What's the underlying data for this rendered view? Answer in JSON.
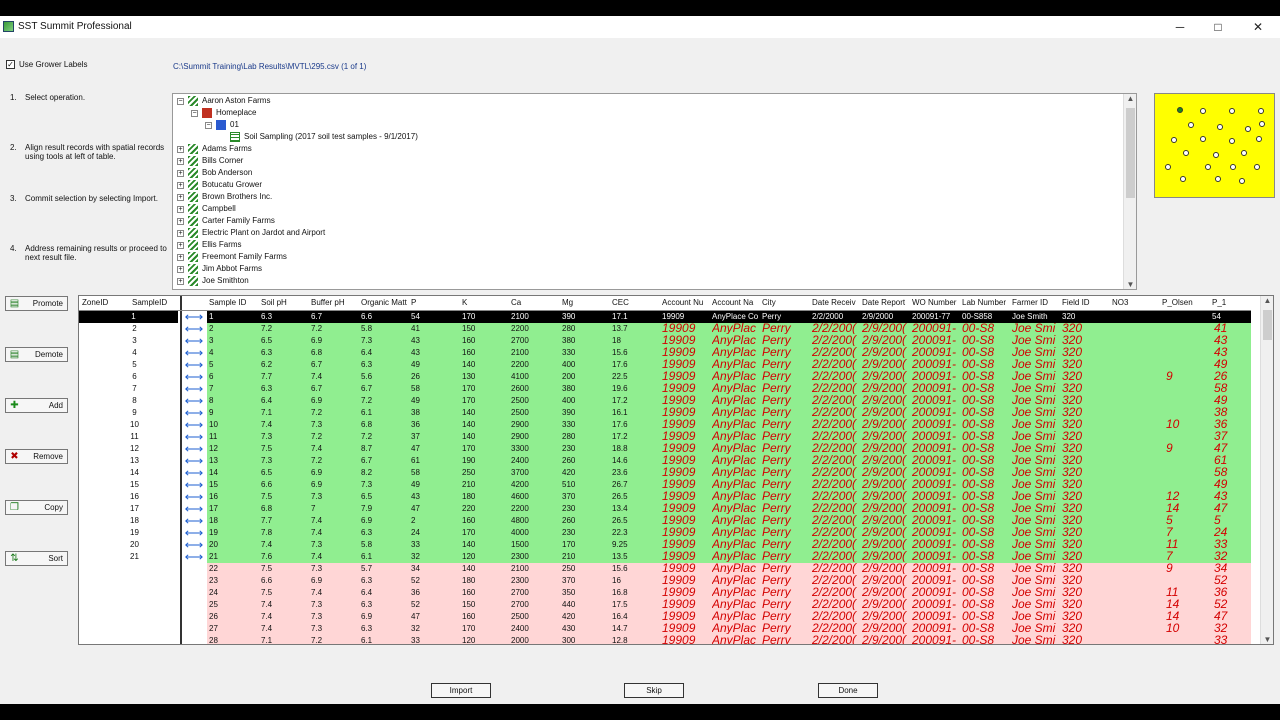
{
  "window": {
    "title": "SST Summit Professional",
    "minimize": "─",
    "maximize": "□",
    "close": "✕"
  },
  "options": {
    "use_grower_labels": "Use Grower Labels",
    "checked": "✓"
  },
  "file_path": "C:\\Summit Training\\Lab Results\\MVTL\\295.csv (1 of 1)",
  "steps": [
    {
      "num": "1.",
      "text": "Select operation."
    },
    {
      "num": "2.",
      "text": "Align result records with spatial records using tools at left of table."
    },
    {
      "num": "3.",
      "text": "Commit selection by selecting Import."
    },
    {
      "num": "4.",
      "text": "Address remaining results or proceed to next result file."
    }
  ],
  "tree": [
    {
      "exp": "−",
      "label": "Aaron Aston Farms",
      "level": 0,
      "icon": "farm-icon"
    },
    {
      "exp": "−",
      "label": "Homeplace",
      "level": 1,
      "icon": "barn-icon"
    },
    {
      "exp": "−",
      "label": "01",
      "level": 2,
      "icon": "field-icon"
    },
    {
      "exp": "",
      "label": "Soil Sampling (2017 soil test samples - 9/1/2017)",
      "level": 3,
      "icon": "sampling-icon"
    },
    {
      "exp": "+",
      "label": "Adams Farms",
      "level": 0,
      "icon": "farm-icon"
    },
    {
      "exp": "+",
      "label": "Bills Corner",
      "level": 0,
      "icon": "farm-icon"
    },
    {
      "exp": "+",
      "label": "Bob Anderson",
      "level": 0,
      "icon": "farm-icon"
    },
    {
      "exp": "+",
      "label": "Botucatu Grower",
      "level": 0,
      "icon": "farm-icon"
    },
    {
      "exp": "+",
      "label": "Brown Brothers Inc.",
      "level": 0,
      "icon": "farm-icon"
    },
    {
      "exp": "+",
      "label": "Campbell",
      "level": 0,
      "icon": "farm-icon"
    },
    {
      "exp": "+",
      "label": "Carter Family Farms",
      "level": 0,
      "icon": "farm-icon"
    },
    {
      "exp": "+",
      "label": "Electric Plant on Jardot and Airport",
      "level": 0,
      "icon": "farm-icon"
    },
    {
      "exp": "+",
      "label": "Ellis Farms",
      "level": 0,
      "icon": "farm-icon"
    },
    {
      "exp": "+",
      "label": "Freemont Family Farms",
      "level": 0,
      "icon": "farm-icon"
    },
    {
      "exp": "+",
      "label": "Jim Abbot Farms",
      "level": 0,
      "icon": "farm-icon"
    },
    {
      "exp": "+",
      "label": "Joe Smithton",
      "level": 0,
      "icon": "farm-icon"
    }
  ],
  "side_buttons": [
    {
      "label": "Promote",
      "icon": "promote-icon",
      "glyph": "▤",
      "color": "#1a7a1a"
    },
    {
      "label": "Demote",
      "icon": "demote-icon",
      "glyph": "▤",
      "color": "#1a7a1a"
    },
    {
      "label": "Add",
      "icon": "add-icon",
      "glyph": "✚",
      "color": "#1a8a1a"
    },
    {
      "label": "Remove",
      "icon": "remove-icon",
      "glyph": "✖",
      "color": "#b00000"
    },
    {
      "label": "Copy",
      "icon": "copy-icon",
      "glyph": "❐",
      "color": "#1a7a1a"
    },
    {
      "label": "Sort",
      "icon": "sort-icon",
      "glyph": "⇅",
      "color": "#1a7a1a"
    }
  ],
  "left_table": {
    "headers": [
      "ZoneID",
      "SampleID"
    ],
    "sample_ids": [
      "1",
      "2",
      "3",
      "4",
      "5",
      "6",
      "7",
      "8",
      "9",
      "10",
      "11",
      "12",
      "13",
      "14",
      "15",
      "16",
      "17",
      "18",
      "19",
      "20",
      "21"
    ]
  },
  "result_table": {
    "headers": [
      "Sample ID",
      "Soil pH",
      "Buffer pH",
      "Organic Matt",
      "P",
      "K",
      "Ca",
      "Mg",
      "CEC",
      "Account Nu",
      "Account Na",
      "City",
      "Date Receiv",
      "Date Report",
      "WO Number",
      "Lab Number",
      "Farmer ID",
      "Field ID",
      "NO3",
      "P_Olsen",
      "P_1"
    ],
    "selected_row": [
      "1",
      "6.3",
      "6.7",
      "6.6",
      "54",
      "170",
      "2100",
      "390",
      "17.1",
      "19909",
      "AnyPlace Co",
      "Perry",
      "2/2/2000",
      "2/9/2000",
      "200091-77",
      "00-S858",
      "Joe Smith",
      "320",
      "",
      "",
      "54"
    ],
    "rows": [
      [
        "2",
        "7.2",
        "7.2",
        "5.8",
        "41",
        "150",
        "2200",
        "280",
        "13.7",
        "",
        "",
        "41"
      ],
      [
        "3",
        "6.5",
        "6.9",
        "7.3",
        "43",
        "160",
        "2700",
        "380",
        "18",
        "",
        "",
        "43"
      ],
      [
        "4",
        "6.3",
        "6.8",
        "6.4",
        "43",
        "160",
        "2100",
        "330",
        "15.6",
        "",
        "",
        "43"
      ],
      [
        "5",
        "6.2",
        "6.7",
        "6.3",
        "49",
        "140",
        "2200",
        "400",
        "17.6",
        "",
        "",
        "49"
      ],
      [
        "6",
        "7.7",
        "7.4",
        "5.6",
        "26",
        "130",
        "4100",
        "200",
        "22.5",
        "",
        "9",
        "26"
      ],
      [
        "7",
        "6.3",
        "6.7",
        "6.7",
        "58",
        "170",
        "2600",
        "380",
        "19.6",
        "",
        "",
        "58"
      ],
      [
        "8",
        "6.4",
        "6.9",
        "7.2",
        "49",
        "170",
        "2500",
        "400",
        "17.2",
        "",
        "",
        "49"
      ],
      [
        "9",
        "7.1",
        "7.2",
        "6.1",
        "38",
        "140",
        "2500",
        "390",
        "16.1",
        "",
        "",
        "38"
      ],
      [
        "10",
        "7.4",
        "7.3",
        "6.8",
        "36",
        "140",
        "2900",
        "330",
        "17.6",
        "",
        "10",
        "36"
      ],
      [
        "11",
        "7.3",
        "7.2",
        "7.2",
        "37",
        "140",
        "2900",
        "280",
        "17.2",
        "",
        "",
        "37"
      ],
      [
        "12",
        "7.5",
        "7.4",
        "8.7",
        "47",
        "170",
        "3300",
        "230",
        "18.8",
        "",
        "9",
        "47"
      ],
      [
        "13",
        "7.3",
        "7.2",
        "6.7",
        "61",
        "190",
        "2400",
        "260",
        "14.6",
        "",
        "",
        "61"
      ],
      [
        "14",
        "6.5",
        "6.9",
        "8.2",
        "58",
        "250",
        "3700",
        "420",
        "23.6",
        "",
        "",
        "58"
      ],
      [
        "15",
        "6.6",
        "6.9",
        "7.3",
        "49",
        "210",
        "4200",
        "510",
        "26.7",
        "",
        "",
        "49"
      ],
      [
        "16",
        "7.5",
        "7.3",
        "6.5",
        "43",
        "180",
        "4600",
        "370",
        "26.5",
        "",
        "12",
        "43"
      ],
      [
        "17",
        "6.8",
        "7",
        "7.9",
        "47",
        "220",
        "2200",
        "230",
        "13.4",
        "",
        "14",
        "47"
      ],
      [
        "18",
        "7.7",
        "7.4",
        "6.9",
        "2",
        "160",
        "4800",
        "260",
        "26.5",
        "",
        "5",
        "5"
      ],
      [
        "19",
        "7.8",
        "7.4",
        "6.3",
        "24",
        "170",
        "4000",
        "230",
        "22.3",
        "",
        "7",
        "24"
      ],
      [
        "20",
        "7.4",
        "7.3",
        "5.8",
        "33",
        "140",
        "1500",
        "170",
        "9.25",
        "",
        "11",
        "33"
      ],
      [
        "21",
        "7.6",
        "7.4",
        "6.1",
        "32",
        "120",
        "2300",
        "210",
        "13.5",
        "",
        "7",
        "32"
      ],
      [
        "22",
        "7.5",
        "7.3",
        "5.7",
        "34",
        "140",
        "2100",
        "250",
        "15.6",
        "",
        "9",
        "34"
      ],
      [
        "23",
        "6.6",
        "6.9",
        "6.3",
        "52",
        "180",
        "2300",
        "370",
        "16",
        "",
        "",
        "52"
      ],
      [
        "24",
        "7.5",
        "7.4",
        "6.4",
        "36",
        "160",
        "2700",
        "350",
        "16.8",
        "",
        "11",
        "36"
      ],
      [
        "25",
        "7.4",
        "7.3",
        "6.3",
        "52",
        "150",
        "2700",
        "440",
        "17.5",
        "",
        "14",
        "52"
      ],
      [
        "26",
        "7.4",
        "7.3",
        "6.9",
        "47",
        "160",
        "2500",
        "420",
        "16.4",
        "",
        "14",
        "47"
      ],
      [
        "27",
        "7.4",
        "7.3",
        "6.3",
        "32",
        "170",
        "2400",
        "430",
        "14.7",
        "",
        "10",
        "32"
      ],
      [
        "28",
        "7.1",
        "7.2",
        "6.1",
        "33",
        "120",
        "2000",
        "300",
        "12.8",
        "",
        "",
        "33"
      ]
    ],
    "red_acct": "19909",
    "red_name": "AnyPlac",
    "red_city": "Perry",
    "red_recv": "2/2/200(",
    "red_report": "2/9/200(",
    "red_wo": "200091-",
    "red_lab_prefix": "00-S8",
    "red_farmer": "Joe Smi",
    "red_field": "320"
  },
  "bottom_buttons": {
    "import": "Import",
    "skip": "Skip",
    "done": "Done"
  }
}
